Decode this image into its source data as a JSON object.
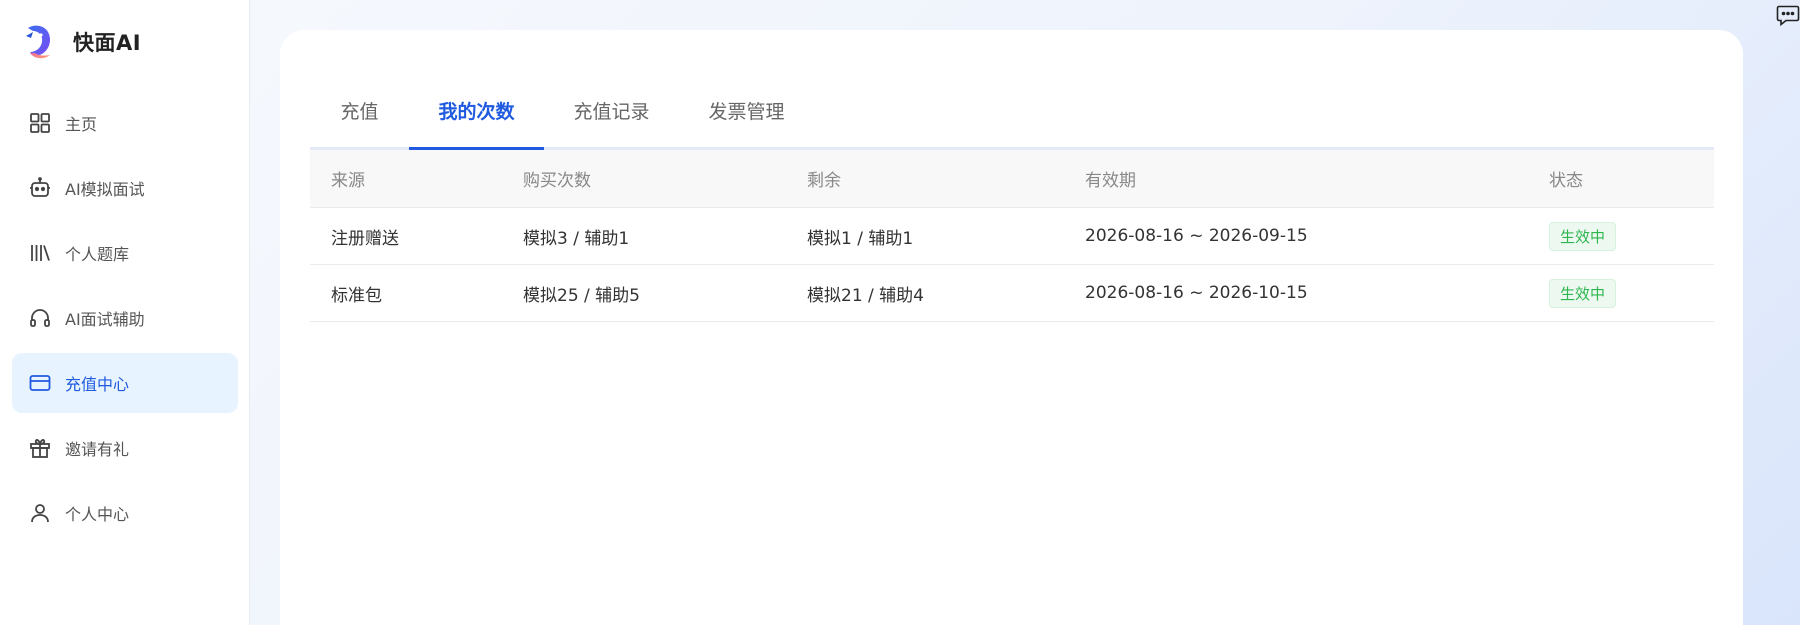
{
  "app": {
    "name": "快面AI"
  },
  "sidebar": {
    "items": [
      {
        "label": "主页",
        "icon": "grid-icon",
        "active": false
      },
      {
        "label": "AI模拟面试",
        "icon": "robot-icon",
        "active": false
      },
      {
        "label": "个人题库",
        "icon": "library-icon",
        "active": false
      },
      {
        "label": "AI面试辅助",
        "icon": "headphones-icon",
        "active": false
      },
      {
        "label": "充值中心",
        "icon": "credit-card-icon",
        "active": true
      },
      {
        "label": "邀请有礼",
        "icon": "gift-icon",
        "active": false
      },
      {
        "label": "个人中心",
        "icon": "user-icon",
        "active": false
      }
    ]
  },
  "tabs": [
    {
      "label": "充值",
      "active": false
    },
    {
      "label": "我的次数",
      "active": true
    },
    {
      "label": "充值记录",
      "active": false
    },
    {
      "label": "发票管理",
      "active": false
    }
  ],
  "table": {
    "headers": [
      "来源",
      "购买次数",
      "剩余",
      "有效期",
      "状态"
    ],
    "rows": [
      {
        "source": "注册赠送",
        "purchased": "模拟3 / 辅助1",
        "remaining": "模拟1 / 辅助1",
        "validity": "2026-08-16 ~ 2026-09-15",
        "status": "生效中"
      },
      {
        "source": "标准包",
        "purchased": "模拟25 / 辅助5",
        "remaining": "模拟21 / 辅助4",
        "validity": "2026-08-16 ~ 2026-10-15",
        "status": "生效中"
      }
    ]
  },
  "colors": {
    "accent": "#1f5ae0",
    "active_bg": "#e7f4ff",
    "status_green": "#2db54f"
  }
}
